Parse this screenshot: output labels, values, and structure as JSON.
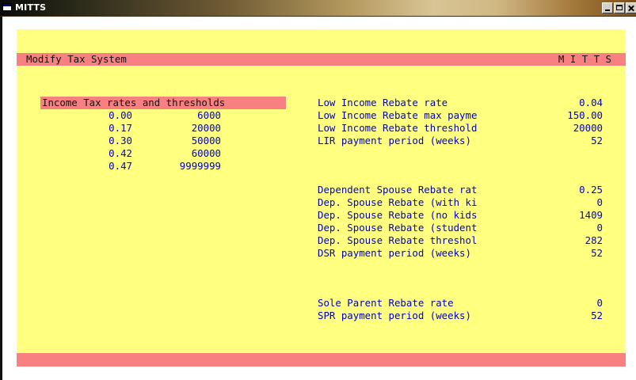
{
  "window": {
    "title": "MITTS",
    "icon": "window-system-icon",
    "buttons": [
      "minimize-icon",
      "maximize-icon",
      "close-icon"
    ]
  },
  "header": {
    "title": "Modify Tax System",
    "app": "M I T T S"
  },
  "income_tax": {
    "heading": "Income Tax rates and thresholds",
    "rows": [
      {
        "rate": "0.00",
        "threshold": "6000"
      },
      {
        "rate": "0.17",
        "threshold": "20000"
      },
      {
        "rate": "0.30",
        "threshold": "50000"
      },
      {
        "rate": "0.42",
        "threshold": "60000"
      },
      {
        "rate": "0.47",
        "threshold": "9999999"
      }
    ]
  },
  "lir": [
    {
      "label": "Low Income Rebate rate",
      "value": "0.04"
    },
    {
      "label": "Low Income Rebate max payme",
      "value": "150.00"
    },
    {
      "label": "Low Income Rebate threshold",
      "value": "20000"
    },
    {
      "label": "LIR payment period (weeks)",
      "value": "52"
    }
  ],
  "dsr": [
    {
      "label": "Dependent Spouse Rebate rat",
      "value": "0.25"
    },
    {
      "label": "Dep. Spouse Rebate (with ki",
      "value": "0"
    },
    {
      "label": "Dep. Spouse Rebate (no kids",
      "value": "1409"
    },
    {
      "label": "Dep. Spouse Rebate (student",
      "value": "0"
    },
    {
      "label": "Dep. Spouse Rebate threshol",
      "value": "282"
    },
    {
      "label": "DSR payment period (weeks)",
      "value": "52"
    }
  ],
  "spr": [
    {
      "label": "Sole Parent Rebate rate",
      "value": "0"
    },
    {
      "label": "SPR payment period (weeks)",
      "value": "52"
    }
  ],
  "colors": {
    "panel": "#ffff80",
    "bar": "#f98080",
    "label_text": "#0000c8",
    "text": "#111111"
  }
}
